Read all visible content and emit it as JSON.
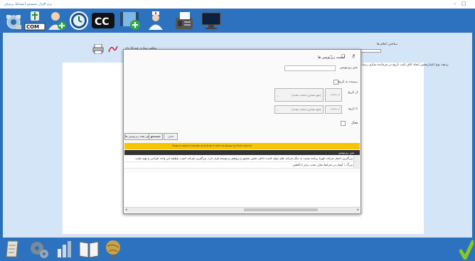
{
  "window": {
    "title": "نرم افزار سیستم انضباط پرسنل"
  },
  "dialog": {
    "title": "لیست زیرنویس ها",
    "fields": {
      "subtitle_text_label": "متن زیرنویس",
      "expired_label": "رسیده به تاریخ",
      "from_date_label": "از تاریخ",
      "to_date_label": "تا تاریخ",
      "active_label": "فعال",
      "date_combo_placeholder": "[هیچ مقداری انتخاب نشده]",
      "number_placeholder": "از ساعت"
    },
    "buttons": {
      "search": "جستجو",
      "clear": "حذف",
      "show_all": "نمایش همه زیرنویس ها"
    },
    "group_bar_text": "Drag a column header and drop it here to group by that column",
    "grid": {
      "column": "متن زیرنویس",
      "rows": [
        "بزرگترین اختبار شرکت کهربا برنامه نسبت به دیگر شرکت های تولید کننده داخلی بخش تحقیق و پژوهش و توسعه قرار دارد، بزرگترین شرکت است. وظیفه این واحد طراحی و تهیه سازه",
        "بزرگ ۱ کیوان در شرایط شارژ شدن برابر با کاهش"
      ]
    }
  },
  "main": {
    "filter_label": "ساختن اعلام ها",
    "radio_label": "مناقب سازی خودکار",
    "info_text": "ردیف نوع اعتباربخش ایجاد اتاق ثابت تاریخ در فرمانده سازی رسانه"
  },
  "toolbar_icons": [
    "network-icon",
    "com-port-icon",
    "add-user-icon",
    "clock-icon",
    "closed-caption-icon",
    "add-video-icon",
    "nurse-icon",
    "fax-icon",
    "monitor-icon"
  ],
  "bottom_icons": [
    "document-icon",
    "settings-icon",
    "chart-icon",
    "book-icon",
    "globe-icon",
    "checkmark-icon"
  ],
  "colors": {
    "toolbar": "#2d72bf",
    "main_bg": "#d5e5f8",
    "group_bar": "#f6c500",
    "grid_header": "#333333"
  }
}
